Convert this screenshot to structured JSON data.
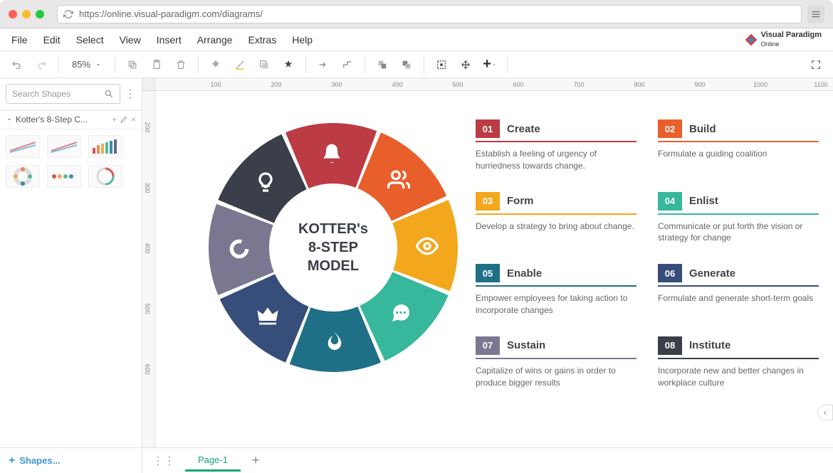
{
  "browser": {
    "url": "https://online.visual-paradigm.com/diagrams/"
  },
  "menu": [
    "File",
    "Edit",
    "Select",
    "View",
    "Insert",
    "Arrange",
    "Extras",
    "Help"
  ],
  "logo_text": "Visual Paradigm\nOnline",
  "toolbar": {
    "zoom": "85%"
  },
  "sidebar": {
    "search_placeholder": "Search Shapes",
    "panel_title": "Kotter's 8-Step C...",
    "add_shapes": "Shapes..."
  },
  "canvas": {
    "center_title": "KOTTER's 8-STEP MODEL",
    "hticks": [
      100,
      200,
      300,
      400,
      500,
      600,
      700,
      800,
      900,
      1000,
      1100
    ],
    "vticks": [
      200,
      300,
      400,
      500,
      600
    ]
  },
  "segments": [
    {
      "color": "#bc3b44",
      "icon": "bell"
    },
    {
      "color": "#e85f2b",
      "icon": "users"
    },
    {
      "color": "#f2a71c",
      "icon": "eye"
    },
    {
      "color": "#37b79b",
      "icon": "chat"
    },
    {
      "color": "#1f6f87",
      "icon": "flame"
    },
    {
      "color": "#374d7a",
      "icon": "crown"
    },
    {
      "color": "#7a7891",
      "icon": "ring"
    },
    {
      "color": "#3a3f4a",
      "icon": "bulb"
    }
  ],
  "steps": [
    {
      "num": "01",
      "title": "Create",
      "desc": "Establish a feeling of urgency of hurriedness towards change.",
      "color": "#bc3b44"
    },
    {
      "num": "02",
      "title": "Build",
      "desc": "Formulate a guiding coalition",
      "color": "#e85f2b"
    },
    {
      "num": "03",
      "title": "Form",
      "desc": "Develop a strategy to bring about change.",
      "color": "#f2a71c"
    },
    {
      "num": "04",
      "title": "Enlist",
      "desc": "Communicate or put forth the vision or strategy for change",
      "color": "#37b79b"
    },
    {
      "num": "05",
      "title": "Enable",
      "desc": "Empower employees for taking action to incorporate changes",
      "color": "#1f6f87"
    },
    {
      "num": "06",
      "title": "Generate",
      "desc": "Formulate and generate short-term goals",
      "color": "#374d7a"
    },
    {
      "num": "07",
      "title": "Sustain",
      "desc": "Capitalize of wins or gains in order to produce bigger results",
      "color": "#7a7891"
    },
    {
      "num": "08",
      "title": "Institute",
      "desc": "Incorporate new and better changes in workplace culture",
      "color": "#3a3f4a"
    }
  ],
  "page_tab": "Page-1"
}
